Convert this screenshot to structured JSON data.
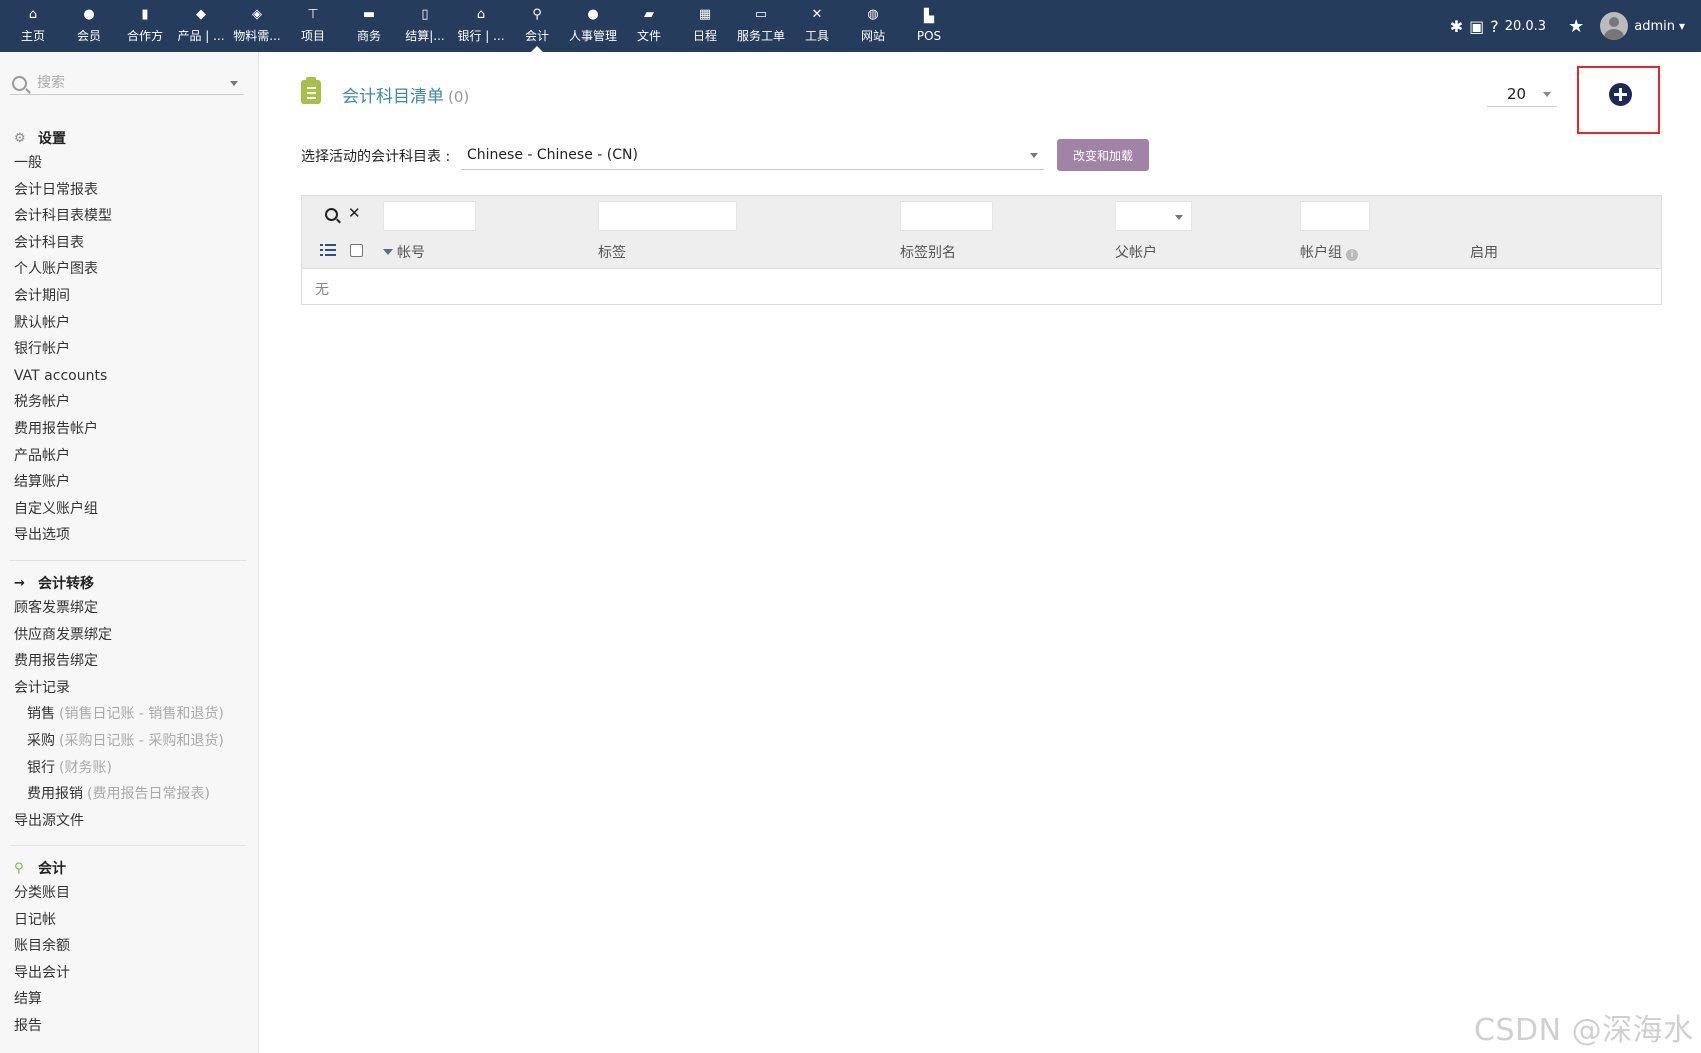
{
  "nav": {
    "items": [
      {
        "label": "主页",
        "icon": "home-icon",
        "glyph": "⌂"
      },
      {
        "label": "会员",
        "icon": "user-icon",
        "glyph": "●"
      },
      {
        "label": "合作方",
        "icon": "building-icon",
        "glyph": "▮"
      },
      {
        "label": "产品 | ...",
        "icon": "cube-icon",
        "glyph": "◆"
      },
      {
        "label": "物料需...",
        "icon": "cubes-icon",
        "glyph": "◈"
      },
      {
        "label": "项目",
        "icon": "sitemap-icon",
        "glyph": "⊤"
      },
      {
        "label": "商务",
        "icon": "suitcase-icon",
        "glyph": "▬"
      },
      {
        "label": "结算|...",
        "icon": "file-invoice-icon",
        "glyph": "▯"
      },
      {
        "label": "银行 | ...",
        "icon": "bank-icon",
        "glyph": "⌂"
      },
      {
        "label": "会计",
        "icon": "search-dollar-icon",
        "glyph": "⚲",
        "active": true
      },
      {
        "label": "人事管理",
        "icon": "user-tie-icon",
        "glyph": "●"
      },
      {
        "label": "文件",
        "icon": "folder-icon",
        "glyph": "▰"
      },
      {
        "label": "日程",
        "icon": "calendar-icon",
        "glyph": "▦"
      },
      {
        "label": "服务工单",
        "icon": "ticket-icon",
        "glyph": "▭"
      },
      {
        "label": "工具",
        "icon": "tools-icon",
        "glyph": "✕"
      },
      {
        "label": "网站",
        "icon": "globe-icon",
        "glyph": "◍"
      },
      {
        "label": "POS",
        "icon": "cash-register-icon",
        "glyph": "▙"
      }
    ],
    "version": "20.0.3",
    "user": "admin"
  },
  "sidebar": {
    "search_placeholder": "搜索",
    "settings": {
      "title": "设置",
      "items": [
        "一般",
        "会计日常报表",
        "会计科目表模型",
        "会计科目表",
        "个人账户图表",
        "会计期间",
        "默认帐户",
        "银行帐户",
        "VAT accounts",
        "税务帐户",
        "费用报告帐户",
        "产品帐户",
        "结算账户",
        "自定义账户组",
        "导出选项"
      ]
    },
    "transfer": {
      "title": "会计转移",
      "items": [
        "顾客发票绑定",
        "供应商发票绑定",
        "费用报告绑定",
        "会计记录"
      ],
      "sub": [
        {
          "label": "销售",
          "hint": "(销售日记账 - 销售和退货)"
        },
        {
          "label": "采购",
          "hint": "(采购日记账 - 采购和退货)"
        },
        {
          "label": "银行",
          "hint": "(财务账)"
        },
        {
          "label": "费用报销",
          "hint": "(费用报告日常报表)"
        }
      ],
      "after": "导出源文件"
    },
    "accounting": {
      "title": "会计",
      "items": [
        "分类账目",
        "日记帐",
        "账目余额",
        "导出会计",
        "结算",
        "报告"
      ]
    }
  },
  "main": {
    "title": "会计科目清单",
    "count": "(0)",
    "limit": "20",
    "chart_label": "选择活动的会计科目表 :",
    "chart_value": "Chinese - Chinese - (CN)",
    "change_button": "改变和加载",
    "columns": {
      "account": "帐号",
      "label": "标签",
      "label_alias": "标签别名",
      "parent": "父帐户",
      "group": "帐户组",
      "enabled": "启用"
    },
    "empty": "无"
  },
  "watermark": "CSDN @深海水"
}
